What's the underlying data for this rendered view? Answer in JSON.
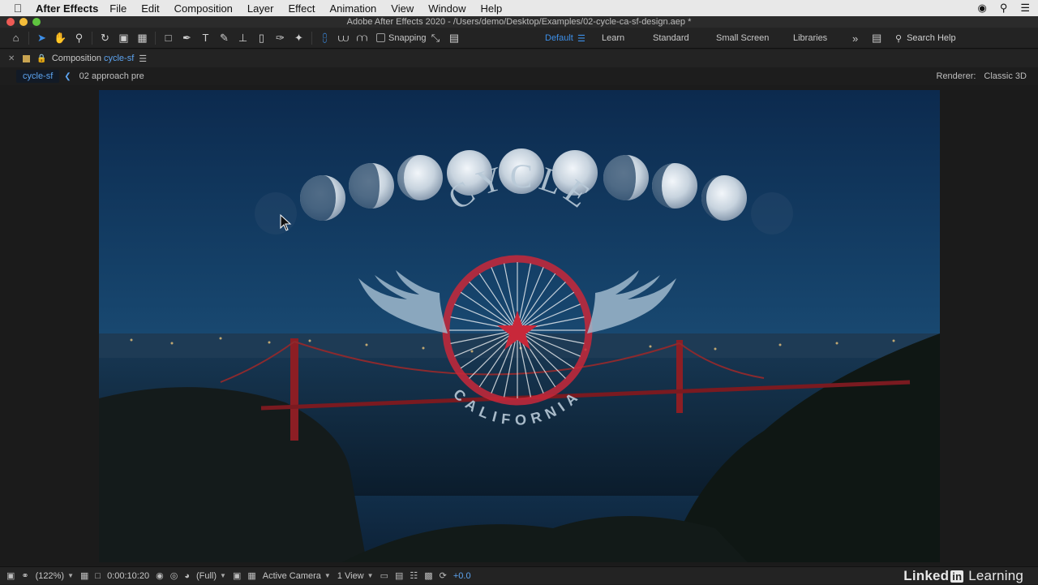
{
  "menubar": {
    "app_name": "After Effects",
    "items": [
      "File",
      "Edit",
      "Composition",
      "Layer",
      "Effect",
      "Animation",
      "View",
      "Window",
      "Help"
    ]
  },
  "window": {
    "title": "Adobe After Effects 2020 - /Users/demo/Desktop/Examples/02-cycle-ca-sf-design.aep *"
  },
  "toolbar": {
    "snapping_label": "Snapping",
    "workspaces": [
      "Default",
      "Learn",
      "Standard",
      "Small Screen",
      "Libraries"
    ],
    "active_workspace": "Default",
    "search_label": "Search Help"
  },
  "panel": {
    "prefix": "Composition",
    "comp_name": "cycle-sf",
    "breadcrumbs": [
      "cycle-sf",
      "02 approach pre"
    ],
    "renderer_label": "Renderer:",
    "renderer_value": "Classic 3D"
  },
  "composition": {
    "logo_top": "CYCLE",
    "logo_bottom": "CALIFORNIA"
  },
  "viewer_controls": {
    "zoom": "(122%)",
    "timecode": "0:00:10:20",
    "resolution": "(Full)",
    "camera": "Active Camera",
    "views": "1 View",
    "exposure": "+0.0"
  },
  "branding": {
    "linkedin_a": "Linked",
    "linkedin_in": "in",
    "linkedin_b": "Learning"
  },
  "colors": {
    "accent": "#3d8fe8",
    "logo_red": "#c8283a",
    "logo_wing": "#9fb8cc"
  }
}
